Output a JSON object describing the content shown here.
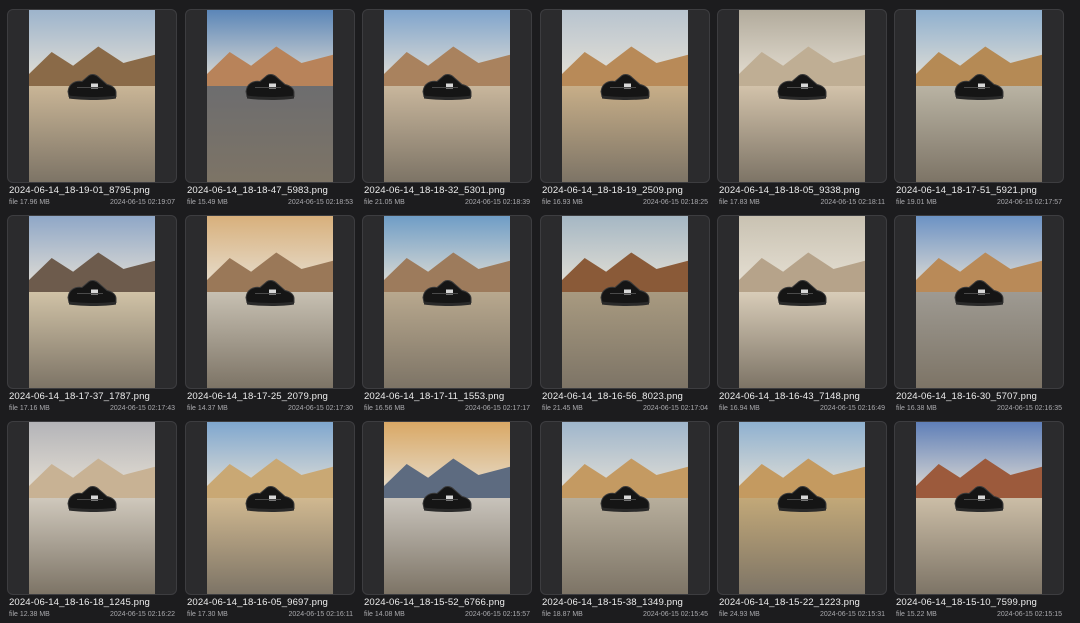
{
  "files": [
    {
      "name": "2024-06-14_18-19-01_8795.png",
      "size": "file 17.96 MB",
      "date": "2024-06-15 02:19:07",
      "sky": "#9db4cc",
      "mtn": "#8a6a48",
      "ground": "#c9b596"
    },
    {
      "name": "2024-06-14_18-18-47_5983.png",
      "size": "file 15.49 MB",
      "date": "2024-06-15 02:18:53",
      "sky": "#5b86b8",
      "mtn": "#b8835a",
      "ground": "#6d6d6f"
    },
    {
      "name": "2024-06-14_18-18-32_5301.png",
      "size": "file 21.05 MB",
      "date": "2024-06-15 02:18:39",
      "sky": "#7fa4cc",
      "mtn": "#a9825e",
      "ground": "#c8b69c"
    },
    {
      "name": "2024-06-14_18-18-19_2509.png",
      "size": "file 16.93 MB",
      "date": "2024-06-15 02:18:25",
      "sky": "#b8c4cf",
      "mtn": "#b88a58",
      "ground": "#c7ae88"
    },
    {
      "name": "2024-06-14_18-18-05_9338.png",
      "size": "file 17.83 MB",
      "date": "2024-06-15 02:18:11",
      "sky": "#b2ab9c",
      "mtn": "#bfae94",
      "ground": "#d2c2aa"
    },
    {
      "name": "2024-06-14_18-17-51_5921.png",
      "size": "file 19.01 MB",
      "date": "2024-06-15 02:17:57",
      "sky": "#8fb0cf",
      "mtn": "#b58a55",
      "ground": "#b9b3a3"
    },
    {
      "name": "2024-06-14_18-17-37_1787.png",
      "size": "file 17.16 MB",
      "date": "2024-06-15 02:17:43",
      "sky": "#8fa7c7",
      "mtn": "#6d5b4c",
      "ground": "#d0c2a6"
    },
    {
      "name": "2024-06-14_18-17-25_2079.png",
      "size": "file 14.37 MB",
      "date": "2024-06-15 02:17:30",
      "sky": "#d8b07c",
      "mtn": "#9a7858",
      "ground": "#c7c0b2"
    },
    {
      "name": "2024-06-14_18-17-11_1553.png",
      "size": "file 16.56 MB",
      "date": "2024-06-15 02:17:17",
      "sky": "#6f9dc6",
      "mtn": "#9d7b5c",
      "ground": "#b8a88e"
    },
    {
      "name": "2024-06-14_18-16-56_8023.png",
      "size": "file 21.45 MB",
      "date": "2024-06-15 02:17:04",
      "sky": "#a5b7c4",
      "mtn": "#8a5a38",
      "ground": "#a89a80"
    },
    {
      "name": "2024-06-14_18-16-43_7148.png",
      "size": "file 16.94 MB",
      "date": "2024-06-15 02:16:49",
      "sky": "#c9c2b2",
      "mtn": "#b6a38a",
      "ground": "#d8ccb8"
    },
    {
      "name": "2024-06-14_18-16-30_5707.png",
      "size": "file 16.38 MB",
      "date": "2024-06-15 02:16:35",
      "sky": "#6c92c4",
      "mtn": "#b98a58",
      "ground": "#9e9a92"
    },
    {
      "name": "2024-06-14_18-16-18_1245.png",
      "size": "file 12.38 MB",
      "date": "2024-06-15 02:16:22",
      "sky": "#b4b4b8",
      "mtn": "#c8b294",
      "ground": "#cfc8bc"
    },
    {
      "name": "2024-06-14_18-16-05_9697.png",
      "size": "file 17.30 MB",
      "date": "2024-06-15 02:16:11",
      "sky": "#7fa7cf",
      "mtn": "#c9a874",
      "ground": "#d0b890"
    },
    {
      "name": "2024-06-14_18-15-52_6766.png",
      "size": "file 14.08 MB",
      "date": "2024-06-15 02:15:57",
      "sky": "#d9a865",
      "mtn": "#5d6b80",
      "ground": "#c8c3bb"
    },
    {
      "name": "2024-06-14_18-15-38_1349.png",
      "size": "file 18.87 MB",
      "date": "2024-06-15 02:15:45",
      "sky": "#9fb6cc",
      "mtn": "#c49a62",
      "ground": "#b7ae9c"
    },
    {
      "name": "2024-06-14_18-15-22_1223.png",
      "size": "file 24.93 MB",
      "date": "2024-06-15 02:15:31",
      "sky": "#8fb1d0",
      "mtn": "#c49a60",
      "ground": "#c2a878"
    },
    {
      "name": "2024-06-14_18-15-10_7599.png",
      "size": "file 15.22 MB",
      "date": "2024-06-15 02:15:15",
      "sky": "#5f7fb8",
      "mtn": "#9c5a3c",
      "ground": "#cbbda6"
    }
  ],
  "icons": {
    "thumbnail_subject": "sneaker-icon"
  }
}
